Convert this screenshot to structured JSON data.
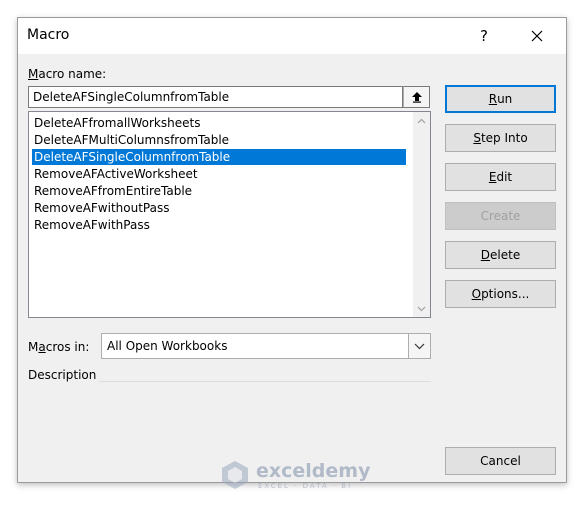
{
  "dialog": {
    "title": "Macro",
    "help_label": "?"
  },
  "macro_name": {
    "label_hotkey": "M",
    "label_rest": "acro name:",
    "value": "DeleteAFSingleColumnfromTable"
  },
  "macros": {
    "items": [
      "DeleteAFfromallWorksheets",
      "DeleteAFMultiColumnsfromTable",
      "DeleteAFSingleColumnfromTable",
      "RemoveAFActiveWorksheet",
      "RemoveAFfromEntireTable",
      "RemoveAFwithoutPass",
      "RemoveAFwithPass"
    ],
    "selected_index": 2
  },
  "buttons": {
    "run": {
      "hotkey": "R",
      "rest": "un"
    },
    "step_into": {
      "hotkey": "S",
      "rest": "tep Into"
    },
    "edit": {
      "hotkey": "E",
      "rest": "dit"
    },
    "create": {
      "label": "Create"
    },
    "delete": {
      "hotkey": "D",
      "rest": "elete"
    },
    "options": {
      "hotkey": "O",
      "rest": "ptions..."
    },
    "cancel": {
      "label": "Cancel"
    }
  },
  "macros_in": {
    "label_pre": "M",
    "label_hotkey": "a",
    "label_post": "cros in:",
    "value": "All Open Workbooks"
  },
  "description": {
    "label": "Description"
  },
  "watermark": {
    "name": "exceldemy",
    "tagline": "EXCEL · DATA · BI"
  },
  "colors": {
    "selection": "#0078d7",
    "default_button_border": "#0078d7",
    "dialog_bg": "#f0f0f0"
  }
}
